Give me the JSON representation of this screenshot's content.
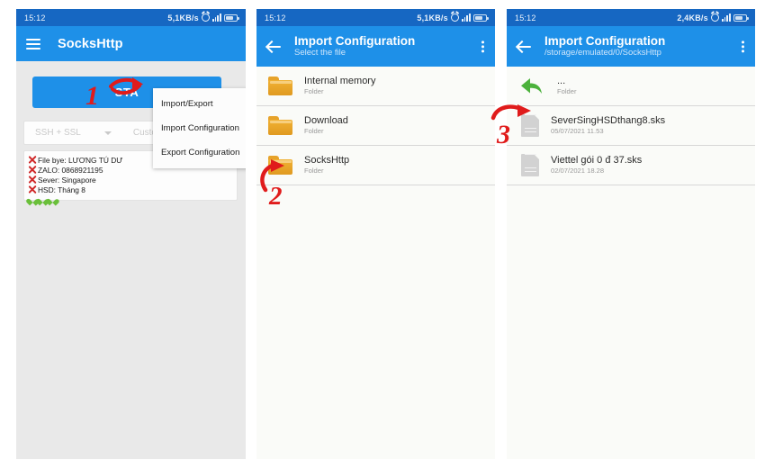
{
  "panel1": {
    "statusbar": {
      "time": "15:12",
      "speed": "5,1KB/s",
      "alarm_icon": "alarm-clock-icon",
      "signal_icon": "signal-bars-icon",
      "battery_icon": "battery-icon"
    },
    "appbar": {
      "menu_icon": "hamburger-menu-icon",
      "title": "SocksHttp"
    },
    "start_button": "STA",
    "protocol_row": {
      "protocol": "SSH + SSL",
      "dropdown_icon": "chevron-down-icon",
      "payload_label": "Custom Payload",
      "toggle_state": "off"
    },
    "info_lines": [
      "File bye: LƯƠNG TÚ DƯ",
      "ZALO: 0868921195",
      "Sever: Singapore",
      "HSD: Tháng 8"
    ],
    "hearts_count": 3,
    "menu": {
      "items": [
        "Import/Export",
        "Import Configuration",
        "Export Configuration"
      ]
    }
  },
  "panel2": {
    "statusbar": {
      "time": "15:12",
      "speed": "5,1KB/s"
    },
    "appbar": {
      "back_icon": "back-arrow-icon",
      "title": "Import Configuration",
      "subtitle": "Select the file",
      "overflow_icon": "kebab-menu-icon"
    },
    "rows": [
      {
        "name": "Internal memory",
        "meta": "Folder",
        "icon": "folder-icon"
      },
      {
        "name": "Download",
        "meta": "Folder",
        "icon": "folder-icon"
      },
      {
        "name": "SocksHttp",
        "meta": "Folder",
        "icon": "folder-icon"
      }
    ]
  },
  "panel3": {
    "statusbar": {
      "time": "15:12",
      "speed": "2,4KB/s"
    },
    "appbar": {
      "back_icon": "back-arrow-icon",
      "title": "Import Configuration",
      "subtitle": "/storage/emulated/0/SocksHttp",
      "overflow_icon": "kebab-menu-icon"
    },
    "parent_row": {
      "name": "...",
      "meta": "Folder",
      "icon": "green-back-arrow-icon"
    },
    "rows": [
      {
        "name": "SeverSingHSDthang8.sks",
        "meta": "05/07/2021 11.53",
        "icon": "file-icon"
      },
      {
        "name": "Viettel gói 0 đ 37.sks",
        "meta": "02/07/2021 18.28",
        "icon": "file-icon"
      }
    ]
  },
  "annotations": [
    {
      "label": "1"
    },
    {
      "label": "2"
    },
    {
      "label": "3"
    }
  ],
  "colors": {
    "statusbar_blue": "#1667c2",
    "appbar_blue": "#1e90e8",
    "annotation_red": "#e01b1b",
    "folder_orange": "#f0b134",
    "heart_green": "#6abf3a",
    "back_arrow_green": "#4cb23c"
  }
}
